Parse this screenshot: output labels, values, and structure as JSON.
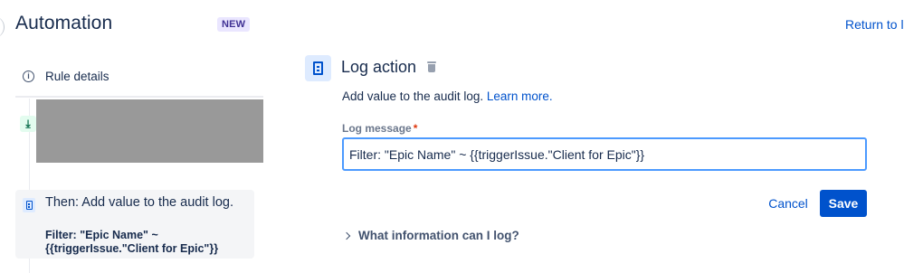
{
  "header": {
    "title": "Automation",
    "badge": "NEW",
    "return_link": "Return to li"
  },
  "sidebar": {
    "rule_details_label": "Rule details",
    "rule_details_icon": "info-icon",
    "trigger_icon": "trigger-icon",
    "action": {
      "icon": "document-icon",
      "title": "Then: Add value to the audit log.",
      "detail": "Filter: \"Epic Name\" ~ {{triggerIssue.\"Client for Epic\"}}"
    }
  },
  "panel": {
    "title": "Log action",
    "description": "Add value to the audit log.",
    "learn_more": "Learn more.",
    "field_label": "Log message",
    "required_marker": "*",
    "field_value": "Filter: \"Epic Name\" ~ {{triggerIssue.\"Client for Epic\"}}",
    "cancel_label": "Cancel",
    "save_label": "Save",
    "expander_label": "What information can I log?"
  },
  "colors": {
    "accent": "#0052cc",
    "focus_border": "#4c9aff",
    "badge_bg": "#eae6ff",
    "badge_text": "#403294",
    "redaction": "#999999"
  }
}
